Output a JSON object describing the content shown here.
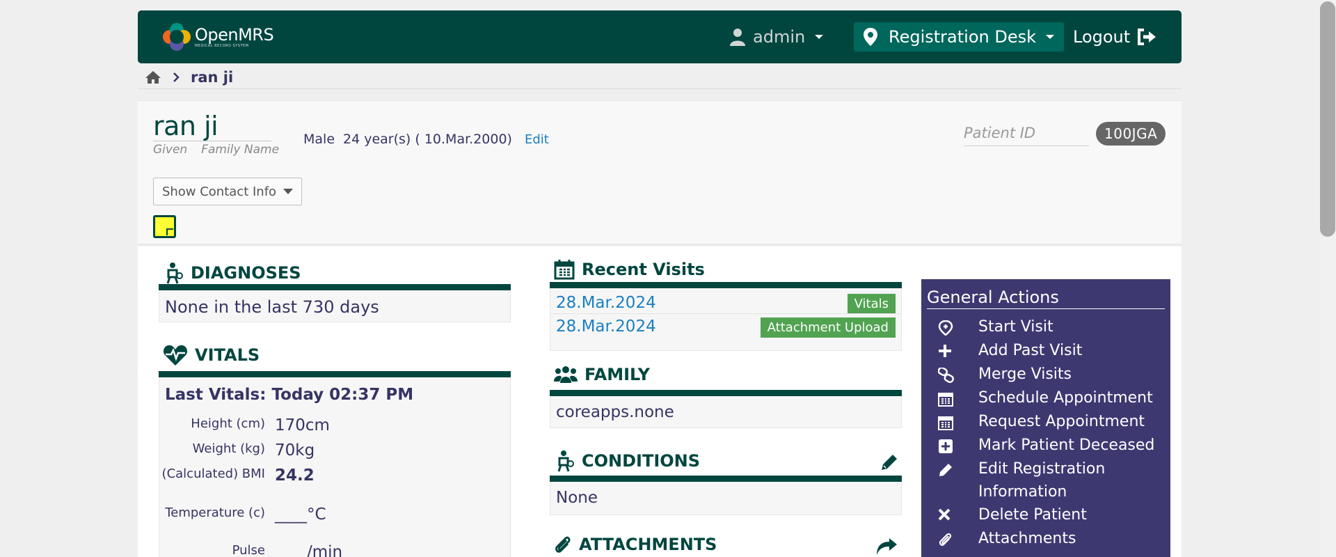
{
  "header": {
    "logo_text": "OpenMRS",
    "logo_sub": "MEDICAL RECORD SYSTEM",
    "user": "admin",
    "location": "Registration Desk",
    "logout": "Logout",
    "colors": {
      "header_bg": "#00463f",
      "location_bg": "#00675c"
    }
  },
  "breadcrumb": {
    "current": "ran ji"
  },
  "patient": {
    "name": "ran ji",
    "given_label": "Given",
    "family_label": "Family Name",
    "gender": "Male",
    "age": "24 year(s) ( 10.Mar.2000)",
    "edit_label": "Edit",
    "patient_id_label": "Patient ID",
    "patient_id": "100JGA",
    "contact_button": "Show Contact Info"
  },
  "diagnoses": {
    "title": "DIAGNOSES",
    "body": "None in the last 730 days"
  },
  "vitals": {
    "title": "VITALS",
    "last": "Last Vitals: Today 02:37 PM",
    "rows": [
      {
        "label": "Height (cm)",
        "value": "170cm"
      },
      {
        "label": "Weight (kg)",
        "value": "70kg"
      },
      {
        "label": "(Calculated) BMI",
        "value": "24.2"
      },
      {
        "label": "Temperature (c)",
        "value": "____°C"
      },
      {
        "label": "Pulse",
        "value": "____/min"
      }
    ]
  },
  "recent_visits": {
    "title": "Recent Visits",
    "visits": [
      {
        "date": "28.Mar.2024",
        "tag": "Vitals"
      },
      {
        "date": "28.Mar.2024",
        "tag": "Attachment Upload"
      }
    ]
  },
  "family": {
    "title": "FAMILY",
    "body": "coreapps.none"
  },
  "conditions": {
    "title": "CONDITIONS",
    "body": "None"
  },
  "attachments": {
    "title": "ATTACHMENTS"
  },
  "general_actions": {
    "title": "General Actions",
    "items": [
      {
        "label": "Start Visit",
        "icon": "start-visit-icon"
      },
      {
        "label": "Add Past Visit",
        "icon": "plus-icon"
      },
      {
        "label": "Merge Visits",
        "icon": "link-icon"
      },
      {
        "label": "Schedule Appointment",
        "icon": "calendar-icon"
      },
      {
        "label": "Request Appointment",
        "icon": "calendar-icon"
      },
      {
        "label": "Mark Patient Deceased",
        "icon": "plus-square-icon"
      },
      {
        "label": "Edit Registration Information",
        "icon": "pencil-icon"
      },
      {
        "label": "Delete Patient",
        "icon": "close-icon"
      },
      {
        "label": "Attachments",
        "icon": "paperclip-icon"
      }
    ],
    "colors": {
      "panel_bg": "#3e3871"
    }
  }
}
